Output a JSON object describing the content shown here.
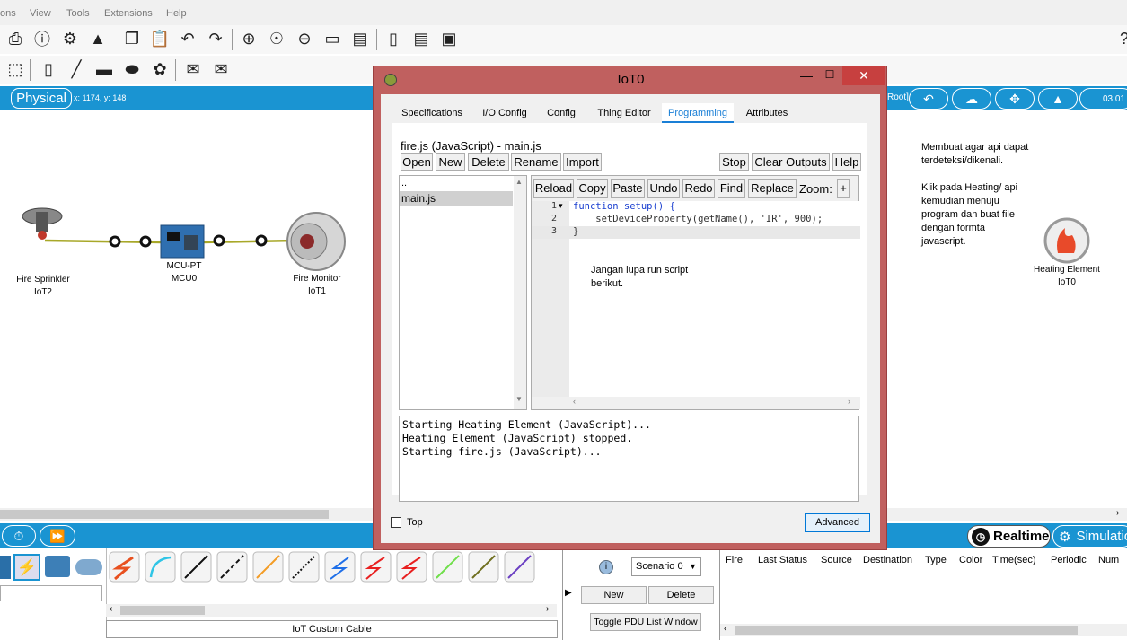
{
  "menu": [
    "ons",
    "View",
    "Tools",
    "Extensions",
    "Help"
  ],
  "workspace": {
    "tab_label": "Physical",
    "coords": "x: 1174, y: 148",
    "root_label": "Root]",
    "clock": "03:01"
  },
  "devices": [
    {
      "name": "Fire Sprinkler",
      "id": "IoT2"
    },
    {
      "name": "MCU-PT",
      "id": "MCU0"
    },
    {
      "name": "Fire Monitor",
      "id": "IoT1"
    },
    {
      "name": "Heating Element",
      "id": "IoT0"
    }
  ],
  "notes": {
    "right": "Membuat agar api dapat\nterdeteksi/dikenali.\n\nKlik pada Heating/ api\nkemudian menuju\nprogram dan buat file\ndengan formta\njavascript.",
    "center": "Jangan lupa run script\nberikut."
  },
  "dialog": {
    "title": "IoT0",
    "tabs": [
      "Specifications",
      "I/O Config",
      "Config",
      "Thing Editor",
      "Programming",
      "Attributes"
    ],
    "active_tab": "Programming",
    "project_label": "fire.js (JavaScript) - main.js",
    "project_buttons": [
      "Open",
      "New",
      "Delete",
      "Rename",
      "Import"
    ],
    "run_buttons": [
      "Stop",
      "Clear Outputs",
      "Help"
    ],
    "editor_buttons": [
      "Reload",
      "Copy",
      "Paste",
      "Undo",
      "Redo",
      "Find",
      "Replace"
    ],
    "zoom_label": "Zoom:",
    "zoom_plus": "+",
    "files": [
      "..",
      "main.js"
    ],
    "selected_file": "main.js",
    "code_lines": [
      {
        "num": "1",
        "fold": "▾",
        "text": "function setup() {"
      },
      {
        "num": "2",
        "fold": "",
        "text": "    setDeviceProperty(getName(), 'IR', 900);"
      },
      {
        "num": "3",
        "fold": "",
        "text": "}"
      }
    ],
    "output": "Starting Heating Element (JavaScript)...\nHeating Element (JavaScript) stopped.\nStarting fire.js (JavaScript)...",
    "top_checkbox": "Top",
    "advanced_button": "Advanced"
  },
  "bottom": {
    "cable_label": "IoT Custom Cable",
    "realtime": "Realtime",
    "simulation": "Simulatio",
    "scenario": "Scenario 0",
    "new_button": "New",
    "delete_button": "Delete",
    "toggle_pdu": "Toggle PDU List Window",
    "event_columns": [
      "Fire",
      "Last Status",
      "Source",
      "Destination",
      "Type",
      "Color",
      "Time(sec)",
      "Periodic",
      "Num"
    ]
  },
  "colors": {
    "accent": "#1a94d2",
    "dialog_frame": "#c0605f",
    "close_button": "#c7403f",
    "link_cable": "#a8a829"
  }
}
